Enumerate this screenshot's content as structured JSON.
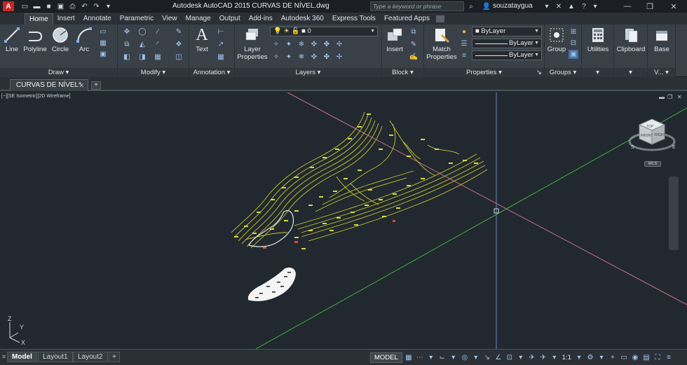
{
  "titlebar": {
    "title": "Autodesk AutoCAD 2015    CURVAS DE NÍVEL.dwg",
    "search_placeholder": "Type a keyword or phrase",
    "user": "souzataygua",
    "qat_icons": [
      "new-icon",
      "open-icon",
      "save-icon",
      "saveas-icon",
      "print-icon",
      "undo-icon",
      "redo-icon"
    ]
  },
  "ribbon_tabs": [
    "Home",
    "Insert",
    "Annotate",
    "Parametric",
    "View",
    "Manage",
    "Output",
    "Add-ins",
    "Autodesk 360",
    "Express Tools",
    "Featured Apps"
  ],
  "draw_panel": {
    "title": "Draw",
    "line": "Line",
    "polyline": "Polyline",
    "circle": "Circle",
    "arc": "Arc"
  },
  "modify_panel": {
    "title": "Modify"
  },
  "annotation_panel": {
    "title": "Annotation",
    "text": "Text"
  },
  "layers_panel": {
    "title": "Layers",
    "layer_properties_1": "Layer",
    "layer_properties_2": "Properties",
    "current_layer": "0"
  },
  "block_panel": {
    "title": "Block",
    "insert": "Insert"
  },
  "properties_panel": {
    "title": "Properties",
    "match_1": "Match",
    "match_2": "Properties",
    "color": "ByLayer",
    "linetype": "ByLayer",
    "lineweight": "ByLayer"
  },
  "groups_panel": {
    "title": "Groups",
    "group": "Group"
  },
  "utilities": {
    "label": "Utilities"
  },
  "clipboard": {
    "label": "Clipboard"
  },
  "base": {
    "label": "Base",
    "view_title": "V..."
  },
  "document_tab": {
    "name": "CURVAS DE NÍVEL*"
  },
  "viewport": {
    "label": "[−][SE Isometric][2D Wireframe]",
    "wcs": "WCS"
  },
  "layout_tabs": [
    "Model",
    "Layout1",
    "Layout2"
  ],
  "status": {
    "model": "MODEL",
    "scale": "1:1"
  },
  "colors": {
    "canvas": "#212830",
    "contour": "#c8c82a",
    "green_axis": "#3fae3f",
    "red_axis": "#c86a8c",
    "blue_axis": "#6b83c4"
  }
}
